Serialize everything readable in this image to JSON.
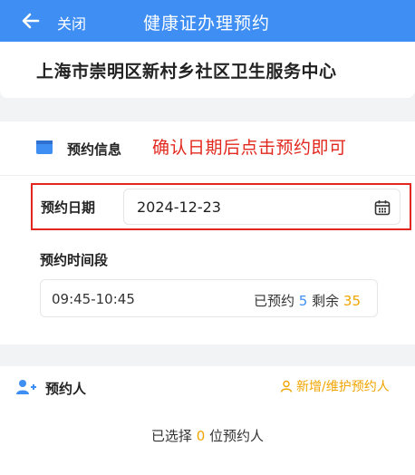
{
  "topbar": {
    "close_label": "关闭",
    "title": "健康证办理预约"
  },
  "center": {
    "name": "上海市崇明区新村乡社区卫生服务中心"
  },
  "appointment": {
    "section_title": "预约信息",
    "annotation": "确认日期后点击预约即可",
    "date_label": "预约日期",
    "date_value": "2024-12-23",
    "slot_label": "预约时间段",
    "slot": {
      "time": "09:45-10:45",
      "booked_label": "已预约",
      "booked": "5",
      "remaining_label": "剩余",
      "remaining": "35"
    }
  },
  "persons": {
    "section_title": "预约人",
    "add_label": "新增/维护预约人",
    "selected_prefix": "已选择",
    "selected_count": "0",
    "selected_suffix": "位预约人"
  },
  "colors": {
    "primary": "#3f8ef3",
    "annotation": "#e2281e",
    "accent": "#f0a500"
  },
  "icons": {
    "back": "arrow-left-icon",
    "section": "calendar-icon",
    "date": "calendar-icon",
    "persons": "add-user-icon",
    "add": "user-outline-icon"
  }
}
